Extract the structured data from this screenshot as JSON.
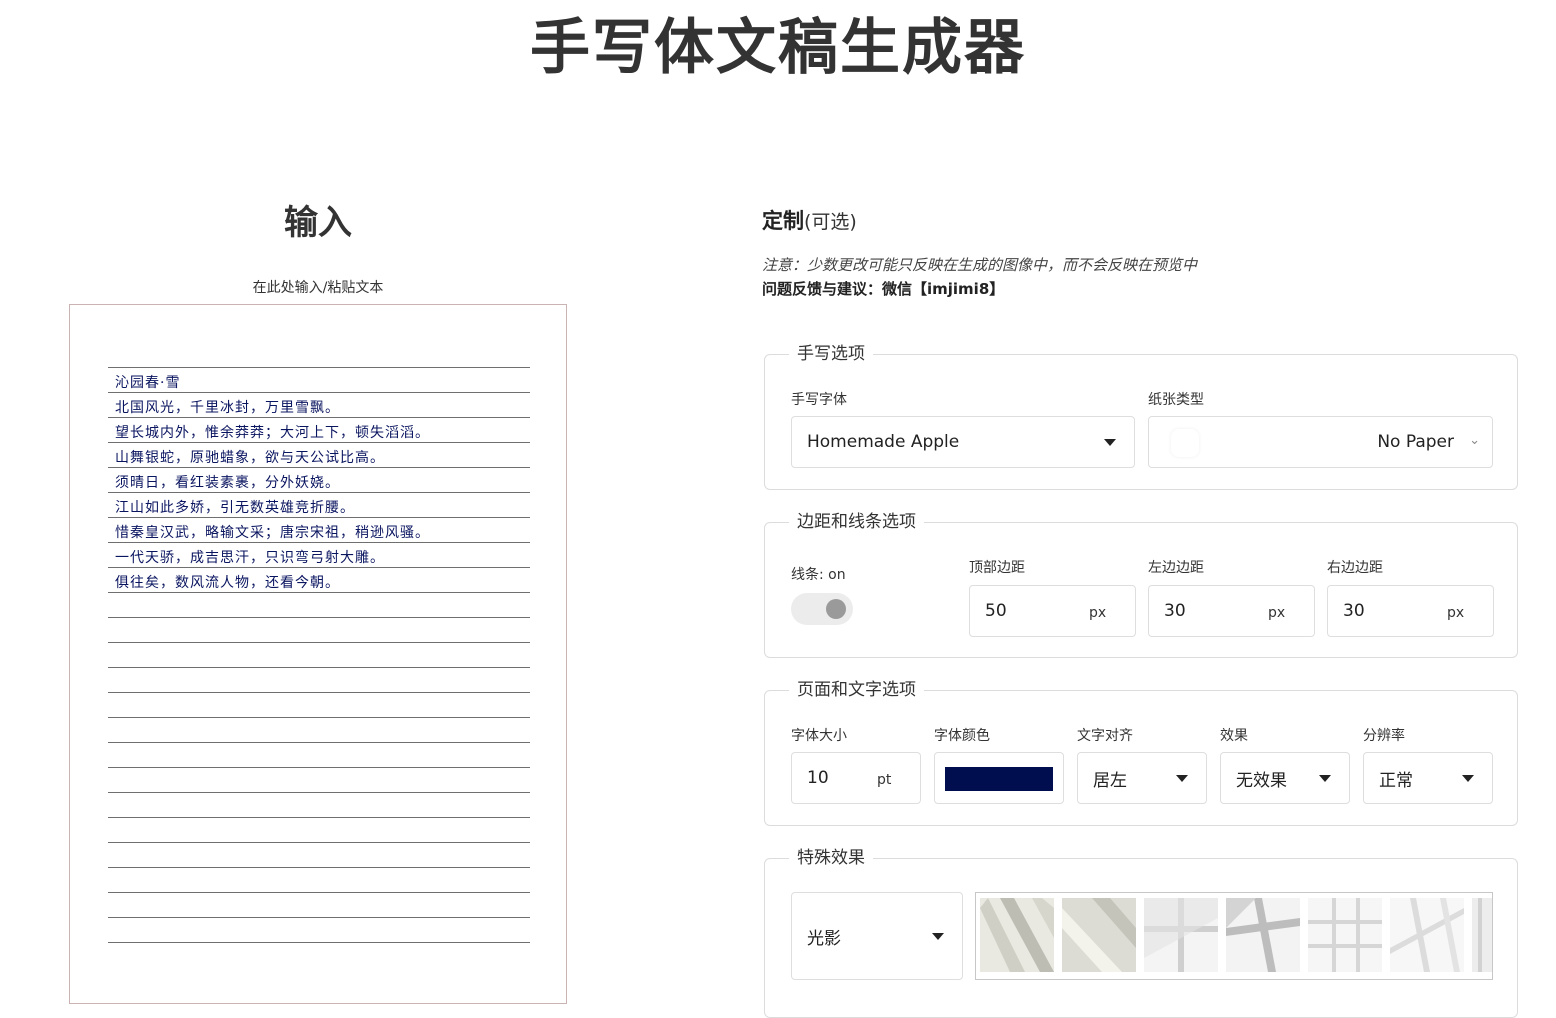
{
  "page": {
    "title": "手写体文稿生成器"
  },
  "input": {
    "heading": "输入",
    "hint": "在此处输入/粘贴文本",
    "lines": [
      "沁园春·雪",
      "北国风光，千里冰封，万里雪飘。",
      "望长城内外，惟余莽莽；大河上下，顿失滔滔。",
      "山舞银蛇，原驰蜡象，欲与天公试比高。",
      "须晴日，看红装素裹，分外妖娆。",
      "江山如此多娇，引无数英雄竞折腰。",
      "惜秦皇汉武，略输文采；唐宗宋祖，稍逊风骚。",
      "一代天骄，成吉思汗，只识弯弓射大雕。",
      "俱往矣，数风流人物，还看今朝。"
    ]
  },
  "customize": {
    "title": "定制",
    "title_suffix": "(可选)",
    "note": "注意：少数更改可能只反映在生成的图像中，而不会反映在预览中",
    "feedback": "问题反馈与建议：微信【imjimi8】"
  },
  "handwriting": {
    "legend": "手写选项",
    "font_label": "手写字体",
    "font_value": "Homemade Apple",
    "paper_label": "纸张类型",
    "paper_value": "No Paper"
  },
  "margins": {
    "legend": "边距和线条选项",
    "lines_label": "线条: on",
    "lines_on": true,
    "top_label": "顶部边距",
    "top_value": "50",
    "left_label": "左边边距",
    "left_value": "30",
    "right_label": "右边边距",
    "right_value": "30",
    "unit": "px"
  },
  "text_options": {
    "legend": "页面和文字选项",
    "size_label": "字体大小",
    "size_value": "10",
    "size_unit": "pt",
    "color_label": "字体颜色",
    "color_value": "#000e4f",
    "align_label": "文字对齐",
    "align_value": "居左",
    "effect_label": "效果",
    "effect_value": "无效果",
    "resolution_label": "分辨率",
    "resolution_value": "正常"
  },
  "special": {
    "legend": "特殊效果",
    "value": "光影"
  },
  "colors": {
    "text": "#333333",
    "ink": "#0a1560",
    "border": "#dcdcdc",
    "paper_border": "#c9b3b3"
  }
}
